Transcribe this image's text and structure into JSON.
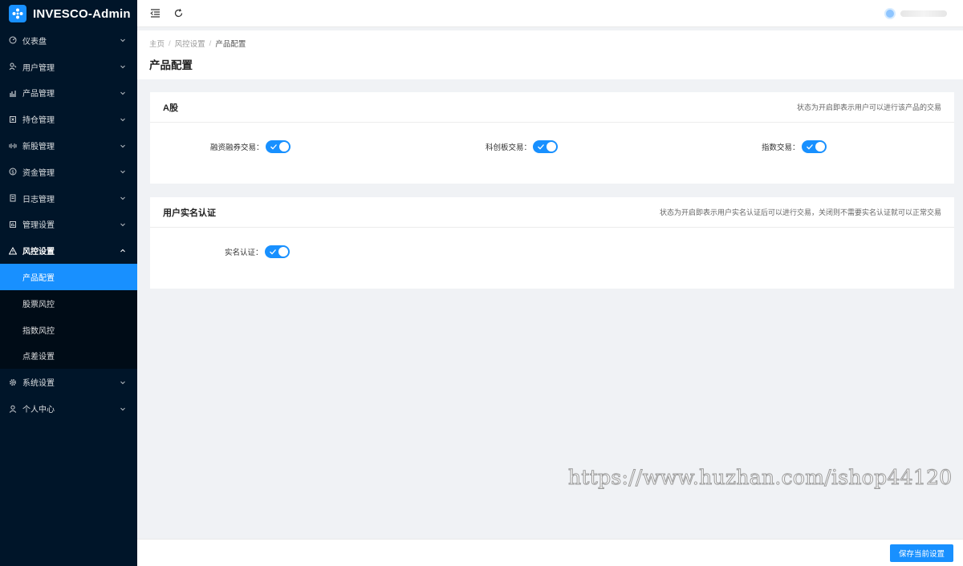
{
  "app": {
    "title": "INVESCO-Admin"
  },
  "sidebar": {
    "items": [
      {
        "label": "仪表盘",
        "icon": "dashboard-icon"
      },
      {
        "label": "用户管理",
        "icon": "users-icon"
      },
      {
        "label": "产品管理",
        "icon": "chart-icon"
      },
      {
        "label": "持仓管理",
        "icon": "position-icon"
      },
      {
        "label": "新股管理",
        "icon": "ipo-icon"
      },
      {
        "label": "资金管理",
        "icon": "money-icon"
      },
      {
        "label": "日志管理",
        "icon": "log-icon"
      },
      {
        "label": "管理设置",
        "icon": "admin-settings-icon"
      },
      {
        "label": "风控设置",
        "icon": "warning-icon",
        "open": true
      }
    ],
    "submenu": [
      {
        "label": "产品配置",
        "active": true
      },
      {
        "label": "股票风控"
      },
      {
        "label": "指数风控"
      },
      {
        "label": "点差设置"
      }
    ],
    "bottom_items": [
      {
        "label": "系统设置",
        "icon": "gear-icon"
      },
      {
        "label": "个人中心",
        "icon": "user-icon"
      }
    ]
  },
  "breadcrumb": {
    "home": "主页",
    "section": "风控设置",
    "current": "产品配置"
  },
  "page": {
    "title": "产品配置"
  },
  "cards": {
    "a_share": {
      "title": "A股",
      "extra": "状态为开启即表示用户可以进行该产品的交易",
      "fields": [
        {
          "label": "融资融券交易：",
          "on": true
        },
        {
          "label": "科创板交易：",
          "on": true
        },
        {
          "label": "指数交易：",
          "on": true
        }
      ]
    },
    "realname": {
      "title": "用户实名认证",
      "extra": "状态为开启即表示用户实名认证后可以进行交易，关闭则不需要实名认证就可以正常交易",
      "fields": [
        {
          "label": "实名认证：",
          "on": true
        }
      ]
    }
  },
  "watermark": "https://www.huzhan.com/ishop44120",
  "footer": {
    "save_label": "保存当前设置"
  },
  "colors": {
    "accent": "#1890ff",
    "sidebar_bg": "#001529",
    "submenu_bg": "#000c17"
  }
}
